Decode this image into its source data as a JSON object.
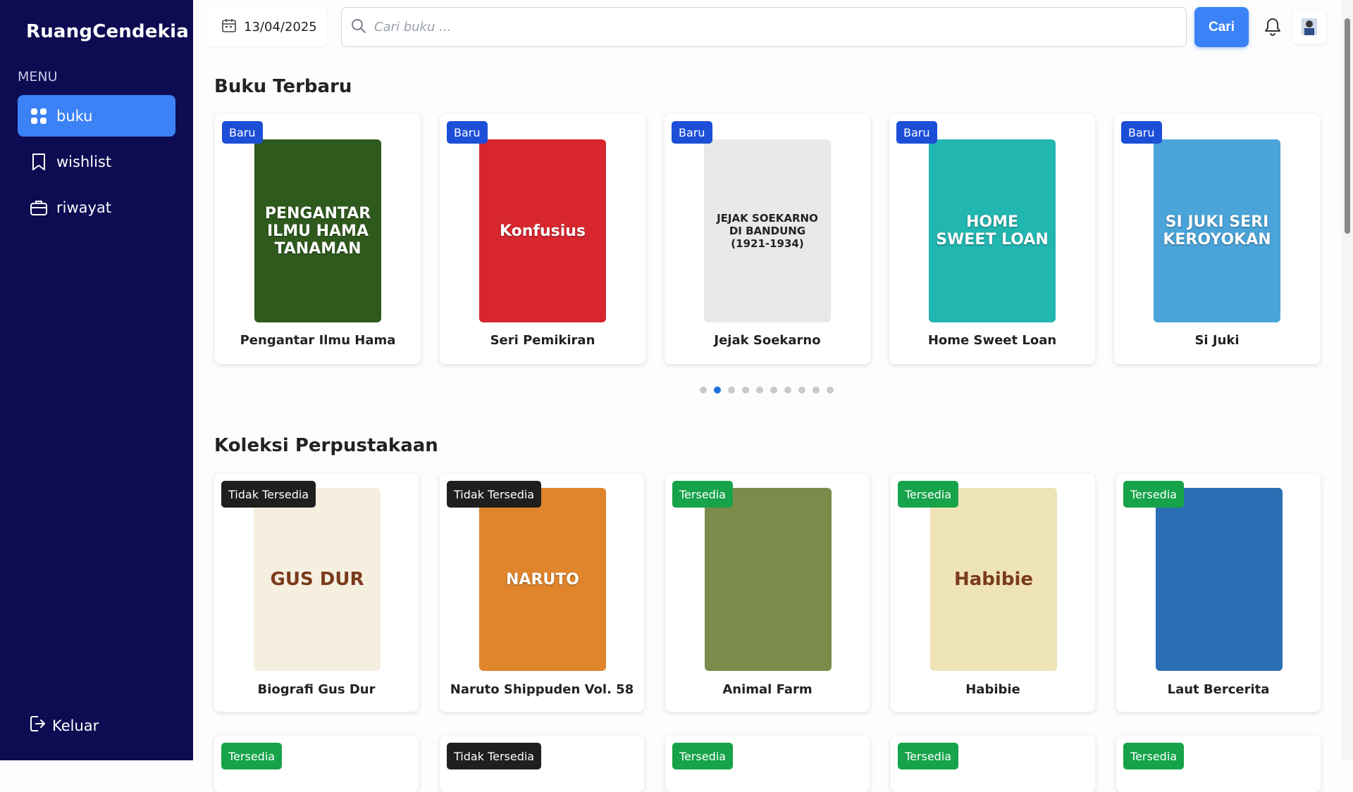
{
  "sidebar": {
    "brand": "RuangCendekia",
    "menu_label": "MENU",
    "items": [
      {
        "label": "buku",
        "icon": "grid-icon",
        "active": true
      },
      {
        "label": "wishlist",
        "icon": "bookmark-icon",
        "active": false
      },
      {
        "label": "riwayat",
        "icon": "briefcase-icon",
        "active": false
      }
    ],
    "logout_label": "Keluar"
  },
  "topbar": {
    "date": "13/04/2025",
    "search_placeholder": "Cari buku ...",
    "search_button": "Cari"
  },
  "new_books": {
    "title": "Buku Terbaru",
    "items": [
      {
        "badge": "Baru",
        "title": "Pengantar Ilmu Hama",
        "cover_text": "PENGANTAR ILMU HAMA TANAMAN",
        "cover_color": "#2f5a1d"
      },
      {
        "badge": "Baru",
        "title": "Seri Pemikiran",
        "cover_text": "Konfusius",
        "cover_color": "#d8262f"
      },
      {
        "badge": "Baru",
        "title": "Jejak Soekarno",
        "cover_text": "JEJAK SOEKARNO DI BANDUNG (1921-1934)",
        "cover_color": "#e9e9e9"
      },
      {
        "badge": "Baru",
        "title": "Home Sweet Loan",
        "cover_text": "HOME SWEET LOAN",
        "cover_color": "#22b6b0"
      },
      {
        "badge": "Baru",
        "title": "Si Juki",
        "cover_text": "SI JUKI SERI KEROYOKAN",
        "cover_color": "#4aa4d9"
      }
    ],
    "active_dot": 1,
    "dot_count": 10
  },
  "collection": {
    "title": "Koleksi Perpustakaan",
    "items": [
      {
        "badge": "Tidak Tersedia",
        "available": false,
        "title": "Biografi Gus Dur",
        "cover_text": "GUS DUR",
        "cover_color": "#f5efe0"
      },
      {
        "badge": "Tidak Tersedia",
        "available": false,
        "title": "Naruto Shippuden Vol. 58",
        "cover_text": "NARUTO",
        "cover_color": "#e0852b"
      },
      {
        "badge": "Tersedia",
        "available": true,
        "title": "Animal Farm",
        "cover_text": "",
        "cover_color": "#7c8a4a"
      },
      {
        "badge": "Tersedia",
        "available": true,
        "title": "Habibie",
        "cover_text": "Habibie",
        "cover_color": "#efe3b8"
      },
      {
        "badge": "Tersedia",
        "available": true,
        "title": "Laut Bercerita",
        "cover_text": "",
        "cover_color": "#2a6fb3"
      }
    ],
    "next_row": [
      {
        "badge": "Tersedia",
        "available": true
      },
      {
        "badge": "Tidak Tersedia",
        "available": false
      },
      {
        "badge": "Tersedia",
        "available": true
      },
      {
        "badge": "Tersedia",
        "available": true
      },
      {
        "badge": "Tersedia",
        "available": true
      }
    ]
  },
  "colors": {
    "sidebar_bg": "#0d0b52",
    "accent": "#3b82f6",
    "badge_new": "#1d4ed8",
    "available": "#16a34a",
    "unavailable": "#1f1f1f"
  }
}
